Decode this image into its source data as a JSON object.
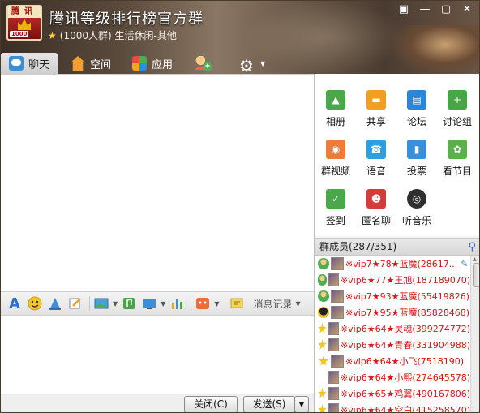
{
  "window": {
    "title": "腾讯等级排行榜官方群",
    "subtitle": "(1000人群) 生活休闲-其他",
    "controls": [
      "▣",
      "—",
      "▢",
      "✕"
    ]
  },
  "avatar": {
    "top_text": "腾讯",
    "badge": "1000"
  },
  "tabs": [
    {
      "label": "聊天",
      "icon": "chat-icon"
    },
    {
      "label": "空间",
      "icon": "home-icon"
    },
    {
      "label": "应用",
      "icon": "apps-icon"
    }
  ],
  "toolbar": {
    "history_label": "消息记录"
  },
  "buttons": {
    "close_label": "关闭(C)",
    "send_label": "发送(S)"
  },
  "apps": [
    {
      "label": "相册",
      "icon": "album-icon",
      "color": "#4aa84a"
    },
    {
      "label": "共享",
      "icon": "folder-icon",
      "color": "#f0a020"
    },
    {
      "label": "论坛",
      "icon": "forum-icon",
      "color": "#2c86d8"
    },
    {
      "label": "讨论组",
      "icon": "discussion-plus-icon",
      "color": "#46a546"
    },
    {
      "label": "群视频",
      "icon": "video-camera-icon",
      "color": "#f07a3a"
    },
    {
      "label": "语音",
      "icon": "voice-icon",
      "color": "#2d9ee0"
    },
    {
      "label": "投票",
      "icon": "vote-chart-icon",
      "color": "#3a8fd8"
    },
    {
      "label": "看节目",
      "icon": "film-reel-icon",
      "color": "#5ab04a"
    },
    {
      "label": "签到",
      "icon": "checkin-icon",
      "color": "#4aa84a"
    },
    {
      "label": "匿名聊",
      "icon": "anonymous-mask-icon",
      "color": "#d83a3a"
    },
    {
      "label": "听音乐",
      "icon": "music-disc-icon",
      "color": "#303030"
    }
  ],
  "members_header": "群成员(287/351)",
  "members": [
    {
      "name": "※vip7★78★蓝魔(28617...",
      "role": "admin-icon"
    },
    {
      "name": "※vip6★77★王旭(187189070)",
      "role": "admin-icon"
    },
    {
      "name": "※vip7★93★蓝魔(55419826)",
      "role": "admin-icon"
    },
    {
      "name": "※vip7★95★蓝魔(85828468)",
      "role": "penguin-icon"
    },
    {
      "name": "※vip6★64★灵魂(399274772)",
      "role": "star-icon"
    },
    {
      "name": "※vip6★64★青春(331904988)",
      "role": "star-icon"
    },
    {
      "name": "※vip6★64★小飞(7518190)",
      "role": "star-icon"
    },
    {
      "name": "※vip6★64★小熙(274645578)",
      "role": "none"
    },
    {
      "name": "※vip6★65★鸡翼(490167806)",
      "role": "star-icon"
    },
    {
      "name": "※vip6★64★空白(415258570)",
      "role": "star-icon"
    }
  ],
  "colors": {
    "member_name": "#e01010",
    "header_dark": "#3a2e26"
  }
}
